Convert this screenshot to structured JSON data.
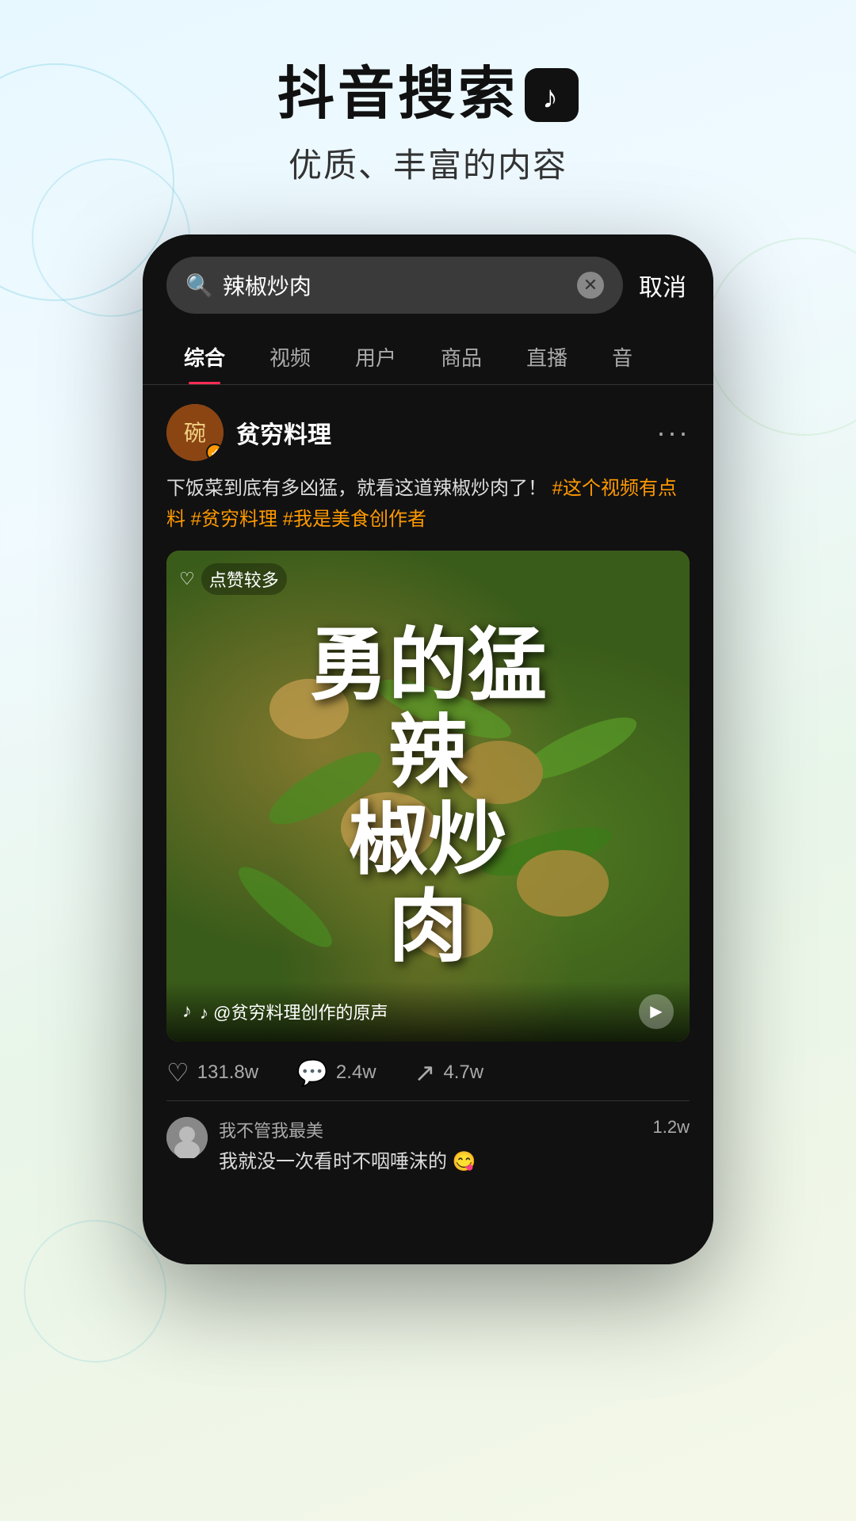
{
  "header": {
    "title": "抖音搜索",
    "logo_symbol": "♪",
    "subtitle": "优质、丰富的内容"
  },
  "phone": {
    "search": {
      "query": "辣椒炒肉",
      "placeholder": "辣椒炒肉",
      "cancel_label": "取消"
    },
    "tabs": [
      {
        "id": "comprehensive",
        "label": "综合",
        "active": true
      },
      {
        "id": "video",
        "label": "视频",
        "active": false
      },
      {
        "id": "user",
        "label": "用户",
        "active": false
      },
      {
        "id": "product",
        "label": "商品",
        "active": false
      },
      {
        "id": "live",
        "label": "直播",
        "active": false
      },
      {
        "id": "audio",
        "label": "音",
        "active": false
      }
    ],
    "post": {
      "account_name": "贫穷料理",
      "verified": true,
      "description": "下饭菜到底有多凶猛，就看这道辣椒炒肉了！",
      "hashtags": [
        "#这个视频有点料",
        "#贫穷料理",
        "#我是美食创作者"
      ],
      "badge_text": "点赞较多",
      "video_title": "勇的猛辣椒炒肉",
      "video_big_text": "勇\n的猛\n辣\n椒炒\n肉",
      "music_text": "♪ @贫穷料理创作的原声",
      "engagement": {
        "likes": "131.8w",
        "comments": "2.4w",
        "shares": "4.7w"
      }
    },
    "comments": [
      {
        "user": "我不管我最美",
        "text": "我就没一次看时不咽唾沫的 😋",
        "likes": "1.2w"
      }
    ]
  }
}
